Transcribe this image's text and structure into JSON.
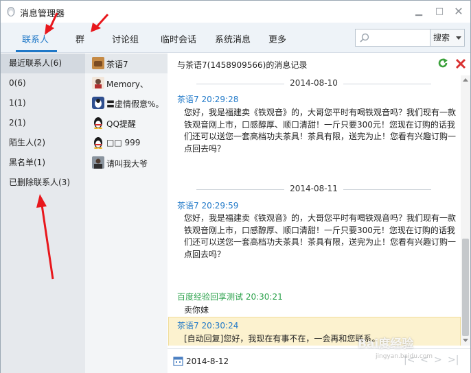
{
  "window": {
    "title": "消息管理器",
    "minimize_glyph": "▁",
    "maximize_glyph": "□",
    "close_glyph": "✕"
  },
  "tabs": [
    {
      "label": "联系人",
      "active": true
    },
    {
      "label": "群",
      "active": false
    },
    {
      "label": "讨论组",
      "active": false
    },
    {
      "label": "临时会话",
      "active": false
    },
    {
      "label": "系统消息",
      "active": false
    },
    {
      "label": "更多",
      "active": false
    }
  ],
  "search": {
    "placeholder": "",
    "button_label": "搜索"
  },
  "categories": [
    {
      "label": "最近联系人(6)",
      "selected": true
    },
    {
      "label": "0(6)",
      "selected": false
    },
    {
      "label": "1(1)",
      "selected": false
    },
    {
      "label": "2(1)",
      "selected": false
    },
    {
      "label": "陌生人(2)",
      "selected": false
    },
    {
      "label": "黑名单(1)",
      "selected": false
    },
    {
      "label": "已删除联系人(3)",
      "selected": false
    }
  ],
  "contacts": [
    {
      "name": "茶语7",
      "avatar_icon": "tea-avatar-icon",
      "avatar_color": "#b97a3c",
      "selected": true
    },
    {
      "name": "   Memory、",
      "avatar_icon": "cartoon-avatar-icon",
      "avatar_color": "#6b4a3a",
      "selected": false
    },
    {
      "name": "〓虚情假意%。",
      "avatar_icon": "penguin-avatar-icon",
      "avatar_color": "#2f4f8f",
      "selected": false
    },
    {
      "name": "QQ提醒",
      "avatar_icon": "qq-penguin-icon",
      "avatar_color": "#e0a020",
      "selected": false
    },
    {
      "name": "□□    999",
      "avatar_icon": "qq-penguin-icon",
      "avatar_color": "#e0a020",
      "selected": false
    },
    {
      "name": "请叫我大爷",
      "avatar_icon": "photo-avatar-icon",
      "avatar_color": "#7d8a96",
      "selected": false
    }
  ],
  "message_panel": {
    "header_title": "与茶语7(1458909566)的消息记录",
    "refresh_icon": "refresh-icon",
    "delete_icon": "delete-icon",
    "groups": [
      {
        "date": "2014-08-10",
        "messages": [
          {
            "sender": "茶语7 20:29:28",
            "sender_color": "#1f78c8",
            "text": "您好，我是福建卖《铁观音》的，大哥您平时有喝铁观音吗？我们现有一款铁观音刚上市，口感醇厚、顺口清甜！一斤只要300元！您现在订购的话我们还可以送您一套高档功夫茶具！茶具有限，送完为止！您看有兴趣订购一点回去吗？"
          }
        ]
      },
      {
        "date": "2014-08-11",
        "messages": [
          {
            "sender": "茶语7 20:29:59",
            "sender_color": "#1f78c8",
            "text": "您好，我是福建卖《铁观音》的，大哥您平时有喝铁观音吗？我们现有一款铁观音刚上市，口感醇厚、顺口清甜！一斤只要300元！您现在订购的话我们还可以送您一套高档功夫茶具！茶具有限，送完为止！您看有兴趣订购一点回去吗？"
          },
          {
            "sender": "百度经验回享测试 20:30:21",
            "sender_color": "#2aa14a",
            "text": "卖你妹"
          },
          {
            "sender": "茶语7 20:30:24",
            "sender_color": "#1f78c8",
            "text": "[自动回复]您好，我现在有事不在，一会再和您联系。"
          }
        ]
      }
    ],
    "footer_date": "2014-8-12",
    "pager": {
      "first": "|<",
      "prev": "<",
      "next": ">",
      "last": ">|"
    }
  },
  "watermark": {
    "text": "Bai度经验",
    "sub": "jingyan.baidu.com"
  },
  "colors": {
    "accent": "#1f78c8",
    "green": "#2aa14a",
    "highlight": "#fcf2cf",
    "arrow": "#e8171c"
  }
}
